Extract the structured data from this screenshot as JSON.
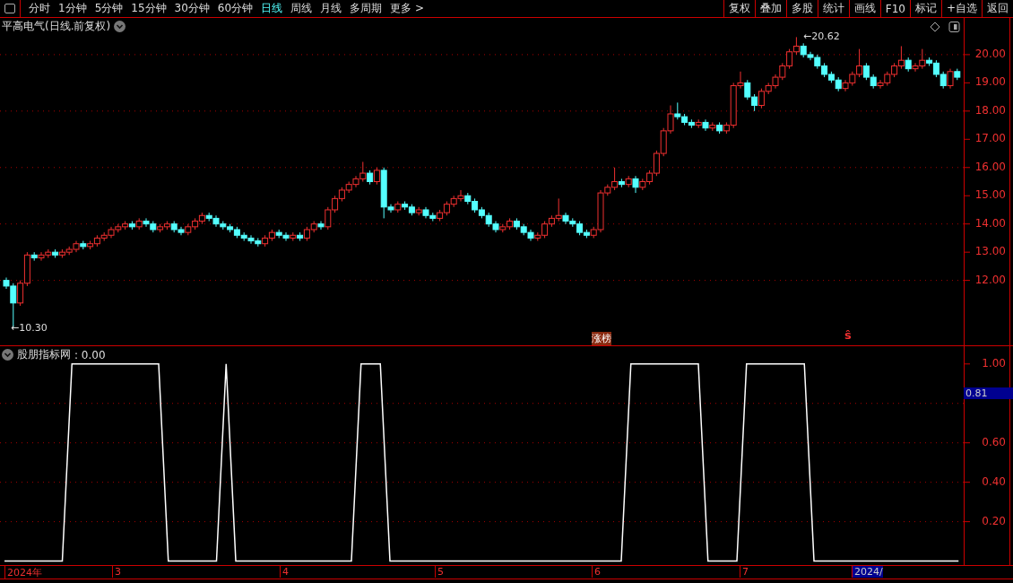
{
  "toolbar": {
    "tabs": [
      {
        "label": "分时",
        "selected": false
      },
      {
        "label": "1分钟",
        "selected": false
      },
      {
        "label": "5分钟",
        "selected": false
      },
      {
        "label": "15分钟",
        "selected": false
      },
      {
        "label": "30分钟",
        "selected": false
      },
      {
        "label": "60分钟",
        "selected": false
      },
      {
        "label": "日线",
        "selected": true
      },
      {
        "label": "周线",
        "selected": false
      },
      {
        "label": "月线",
        "selected": false
      },
      {
        "label": "多周期",
        "selected": false
      },
      {
        "label": "更多 >",
        "selected": false
      }
    ],
    "buttons": [
      "复权",
      "叠加",
      "多股",
      "统计",
      "画线",
      "F10",
      "标记",
      "+自选",
      "返回"
    ]
  },
  "price_panel": {
    "title": "平高电气(日线.前复权)",
    "high_label": "←20.62",
    "low_label": "←10.30",
    "badge": "涨榜",
    "signal": "ŝ",
    "chart_data": {
      "type": "candlestick",
      "ylim": [
        9.7,
        21.3
      ],
      "grid": true,
      "yticks": [
        {
          "value": 20,
          "label": "20.00"
        },
        {
          "value": 19,
          "label": "19.00"
        },
        {
          "value": 18,
          "label": "18.00"
        },
        {
          "value": 17,
          "label": "17.00"
        },
        {
          "value": 16,
          "label": "16.00"
        },
        {
          "value": 15,
          "label": "15.00"
        },
        {
          "value": 14,
          "label": "14.00"
        },
        {
          "value": 13,
          "label": "13.00"
        },
        {
          "value": 12,
          "label": "12.00"
        }
      ],
      "ohlc": [
        [
          12.0,
          12.1,
          11.7,
          11.8
        ],
        [
          11.8,
          11.9,
          10.3,
          11.2
        ],
        [
          11.2,
          12.0,
          11.1,
          11.9
        ],
        [
          11.9,
          13.0,
          11.8,
          12.9
        ],
        [
          12.9,
          13.0,
          12.7,
          12.8
        ],
        [
          12.8,
          13.0,
          12.7,
          12.9
        ],
        [
          12.9,
          13.1,
          12.8,
          13.0
        ],
        [
          13.0,
          13.1,
          12.8,
          12.9
        ],
        [
          12.9,
          13.1,
          12.8,
          13.0
        ],
        [
          13.0,
          13.2,
          12.9,
          13.1
        ],
        [
          13.1,
          13.4,
          13.0,
          13.3
        ],
        [
          13.3,
          13.4,
          13.1,
          13.2
        ],
        [
          13.2,
          13.4,
          13.1,
          13.3
        ],
        [
          13.3,
          13.6,
          13.2,
          13.5
        ],
        [
          13.5,
          13.7,
          13.4,
          13.6
        ],
        [
          13.6,
          13.9,
          13.5,
          13.8
        ],
        [
          13.8,
          14.0,
          13.7,
          13.9
        ],
        [
          13.9,
          14.1,
          13.8,
          14.0
        ],
        [
          14.0,
          14.1,
          13.8,
          13.9
        ],
        [
          13.9,
          14.2,
          13.8,
          14.1
        ],
        [
          14.1,
          14.2,
          13.9,
          14.0
        ],
        [
          14.0,
          14.1,
          13.7,
          13.8
        ],
        [
          13.8,
          14.0,
          13.7,
          13.9
        ],
        [
          13.9,
          14.1,
          13.8,
          14.0
        ],
        [
          14.0,
          14.1,
          13.7,
          13.8
        ],
        [
          13.8,
          13.9,
          13.6,
          13.7
        ],
        [
          13.7,
          14.0,
          13.6,
          13.9
        ],
        [
          13.9,
          14.2,
          13.8,
          14.1
        ],
        [
          14.1,
          14.4,
          14.0,
          14.3
        ],
        [
          14.3,
          14.4,
          14.1,
          14.2
        ],
        [
          14.2,
          14.3,
          13.9,
          14.0
        ],
        [
          14.0,
          14.1,
          13.8,
          13.9
        ],
        [
          13.9,
          14.0,
          13.7,
          13.8
        ],
        [
          13.8,
          13.9,
          13.5,
          13.6
        ],
        [
          13.6,
          13.7,
          13.4,
          13.5
        ],
        [
          13.5,
          13.6,
          13.3,
          13.4
        ],
        [
          13.4,
          13.5,
          13.2,
          13.3
        ],
        [
          13.3,
          13.6,
          13.2,
          13.5
        ],
        [
          13.5,
          13.8,
          13.4,
          13.7
        ],
        [
          13.7,
          13.8,
          13.5,
          13.6
        ],
        [
          13.6,
          13.7,
          13.4,
          13.5
        ],
        [
          13.5,
          13.7,
          13.4,
          13.6
        ],
        [
          13.6,
          13.7,
          13.4,
          13.5
        ],
        [
          13.5,
          13.9,
          13.4,
          13.8
        ],
        [
          13.8,
          14.1,
          13.7,
          14.0
        ],
        [
          14.0,
          14.1,
          13.8,
          13.9
        ],
        [
          13.9,
          14.6,
          13.8,
          14.5
        ],
        [
          14.5,
          15.0,
          14.4,
          14.9
        ],
        [
          14.9,
          15.3,
          14.8,
          15.2
        ],
        [
          15.2,
          15.5,
          15.1,
          15.4
        ],
        [
          15.4,
          15.7,
          15.3,
          15.6
        ],
        [
          15.6,
          16.2,
          15.5,
          15.8
        ],
        [
          15.8,
          15.9,
          15.4,
          15.5
        ],
        [
          15.5,
          16.0,
          15.4,
          15.9
        ],
        [
          15.9,
          16.0,
          14.2,
          14.6
        ],
        [
          14.6,
          14.7,
          14.4,
          14.5
        ],
        [
          14.5,
          14.8,
          14.4,
          14.7
        ],
        [
          14.7,
          14.8,
          14.5,
          14.6
        ],
        [
          14.6,
          14.7,
          14.3,
          14.4
        ],
        [
          14.4,
          14.6,
          14.3,
          14.5
        ],
        [
          14.5,
          14.6,
          14.2,
          14.3
        ],
        [
          14.3,
          14.4,
          14.1,
          14.2
        ],
        [
          14.2,
          14.5,
          14.1,
          14.4
        ],
        [
          14.4,
          14.8,
          14.3,
          14.7
        ],
        [
          14.7,
          15.0,
          14.6,
          14.9
        ],
        [
          14.9,
          15.2,
          14.8,
          15.0
        ],
        [
          15.0,
          15.1,
          14.7,
          14.8
        ],
        [
          14.8,
          14.9,
          14.4,
          14.5
        ],
        [
          14.5,
          14.6,
          14.2,
          14.3
        ],
        [
          14.3,
          14.4,
          13.9,
          14.0
        ],
        [
          14.0,
          14.1,
          13.7,
          13.8
        ],
        [
          13.8,
          14.0,
          13.7,
          13.9
        ],
        [
          13.9,
          14.2,
          13.8,
          14.1
        ],
        [
          14.1,
          14.2,
          13.8,
          13.9
        ],
        [
          13.9,
          14.0,
          13.6,
          13.7
        ],
        [
          13.7,
          13.8,
          13.4,
          13.5
        ],
        [
          13.5,
          13.7,
          13.4,
          13.6
        ],
        [
          13.6,
          14.1,
          13.5,
          14.0
        ],
        [
          14.0,
          14.3,
          13.9,
          14.2
        ],
        [
          14.2,
          14.9,
          14.1,
          14.3
        ],
        [
          14.3,
          14.4,
          14.0,
          14.1
        ],
        [
          14.1,
          14.2,
          13.9,
          14.0
        ],
        [
          14.0,
          14.1,
          13.6,
          13.7
        ],
        [
          13.7,
          13.8,
          13.5,
          13.6
        ],
        [
          13.6,
          13.9,
          13.5,
          13.8
        ],
        [
          13.8,
          15.2,
          13.7,
          15.1
        ],
        [
          15.1,
          15.4,
          15.0,
          15.3
        ],
        [
          15.3,
          16.0,
          15.2,
          15.5
        ],
        [
          15.5,
          15.6,
          15.3,
          15.4
        ],
        [
          15.4,
          15.7,
          15.3,
          15.6
        ],
        [
          15.6,
          15.7,
          15.1,
          15.3
        ],
        [
          15.3,
          15.6,
          15.2,
          15.5
        ],
        [
          15.5,
          15.9,
          15.4,
          15.8
        ],
        [
          15.8,
          16.6,
          15.7,
          16.5
        ],
        [
          16.5,
          17.4,
          16.4,
          17.3
        ],
        [
          17.3,
          18.2,
          17.2,
          17.9
        ],
        [
          17.9,
          18.3,
          17.7,
          17.8
        ],
        [
          17.8,
          17.9,
          17.5,
          17.6
        ],
        [
          17.6,
          17.7,
          17.4,
          17.5
        ],
        [
          17.5,
          17.7,
          17.4,
          17.6
        ],
        [
          17.6,
          17.7,
          17.3,
          17.4
        ],
        [
          17.4,
          17.6,
          17.3,
          17.5
        ],
        [
          17.5,
          17.6,
          17.2,
          17.3
        ],
        [
          17.3,
          17.6,
          17.2,
          17.5
        ],
        [
          17.5,
          19.0,
          17.4,
          18.9
        ],
        [
          18.9,
          19.4,
          18.8,
          19.0
        ],
        [
          19.0,
          19.1,
          18.4,
          18.5
        ],
        [
          18.5,
          18.6,
          18.0,
          18.2
        ],
        [
          18.2,
          18.8,
          18.1,
          18.7
        ],
        [
          18.7,
          19.0,
          18.6,
          18.9
        ],
        [
          18.9,
          19.3,
          18.8,
          19.2
        ],
        [
          19.2,
          19.7,
          19.1,
          19.6
        ],
        [
          19.6,
          20.2,
          19.5,
          20.1
        ],
        [
          20.1,
          20.62,
          20.0,
          20.3
        ],
        [
          20.3,
          20.4,
          19.9,
          20.0
        ],
        [
          20.0,
          20.1,
          19.8,
          19.9
        ],
        [
          19.9,
          20.0,
          19.5,
          19.6
        ],
        [
          19.6,
          19.7,
          19.2,
          19.3
        ],
        [
          19.3,
          19.4,
          19.0,
          19.1
        ],
        [
          19.1,
          19.2,
          18.7,
          18.8
        ],
        [
          18.8,
          19.1,
          18.7,
          19.0
        ],
        [
          19.0,
          19.4,
          18.9,
          19.3
        ],
        [
          19.3,
          20.2,
          19.2,
          19.6
        ],
        [
          19.6,
          19.7,
          19.1,
          19.2
        ],
        [
          19.2,
          19.3,
          18.8,
          18.9
        ],
        [
          18.9,
          19.1,
          18.8,
          19.0
        ],
        [
          19.0,
          19.4,
          18.9,
          19.3
        ],
        [
          19.3,
          19.7,
          19.2,
          19.6
        ],
        [
          19.6,
          20.3,
          19.5,
          19.8
        ],
        [
          19.8,
          19.9,
          19.4,
          19.5
        ],
        [
          19.5,
          19.7,
          19.4,
          19.6
        ],
        [
          19.6,
          20.2,
          19.5,
          19.8
        ],
        [
          19.8,
          19.9,
          19.6,
          19.7
        ],
        [
          19.7,
          19.8,
          19.2,
          19.3
        ],
        [
          19.3,
          19.4,
          18.8,
          18.9
        ],
        [
          18.9,
          19.5,
          18.8,
          19.4
        ],
        [
          19.4,
          19.5,
          19.1,
          19.2
        ]
      ]
    }
  },
  "indicator_panel": {
    "value": ": 0.00",
    "cursor_value": "0.81",
    "chart_data": {
      "type": "line",
      "ylim": [
        -0.02,
        1.09
      ],
      "grid": true,
      "yticks": [
        {
          "value": 1.0,
          "label": "1.00"
        },
        {
          "value": 0.6,
          "label": "0.60"
        },
        {
          "value": 0.4,
          "label": "0.40"
        },
        {
          "value": 0.2,
          "label": "0.20"
        }
      ],
      "series": [
        {
          "name": "股朋指标网",
          "color": "#ffffff",
          "values": [
            0,
            0,
            0,
            0,
            0,
            0,
            0,
            1,
            1,
            1,
            1,
            1,
            1,
            1,
            1,
            1,
            1,
            0,
            0,
            0,
            0,
            0,
            0,
            1,
            0,
            0,
            0,
            0,
            0,
            0,
            0,
            0,
            0,
            0,
            0,
            0,
            0,
            1,
            1,
            1,
            0,
            0,
            0,
            0,
            0,
            0,
            0,
            0,
            0,
            0,
            0,
            0,
            0,
            0,
            0,
            0,
            0,
            0,
            0,
            0,
            0,
            0,
            0,
            0,
            0,
            1,
            1,
            1,
            1,
            1,
            1,
            1,
            1,
            0,
            0,
            0,
            0,
            1,
            1,
            1,
            1,
            1,
            1,
            1,
            0,
            0,
            0,
            0,
            0,
            0,
            0,
            0,
            0,
            0,
            0,
            0,
            0,
            0,
            0,
            0
          ]
        }
      ]
    }
  },
  "date_axis": [
    {
      "label": "2024年",
      "kind": "tick"
    },
    {
      "label": "3",
      "kind": "tick"
    },
    {
      "label": "4",
      "kind": "tick"
    },
    {
      "label": "5",
      "kind": "tick"
    },
    {
      "label": "6",
      "kind": "tick"
    },
    {
      "label": "7",
      "kind": "tick"
    },
    {
      "label": "2024/",
      "kind": "cursor"
    }
  ]
}
